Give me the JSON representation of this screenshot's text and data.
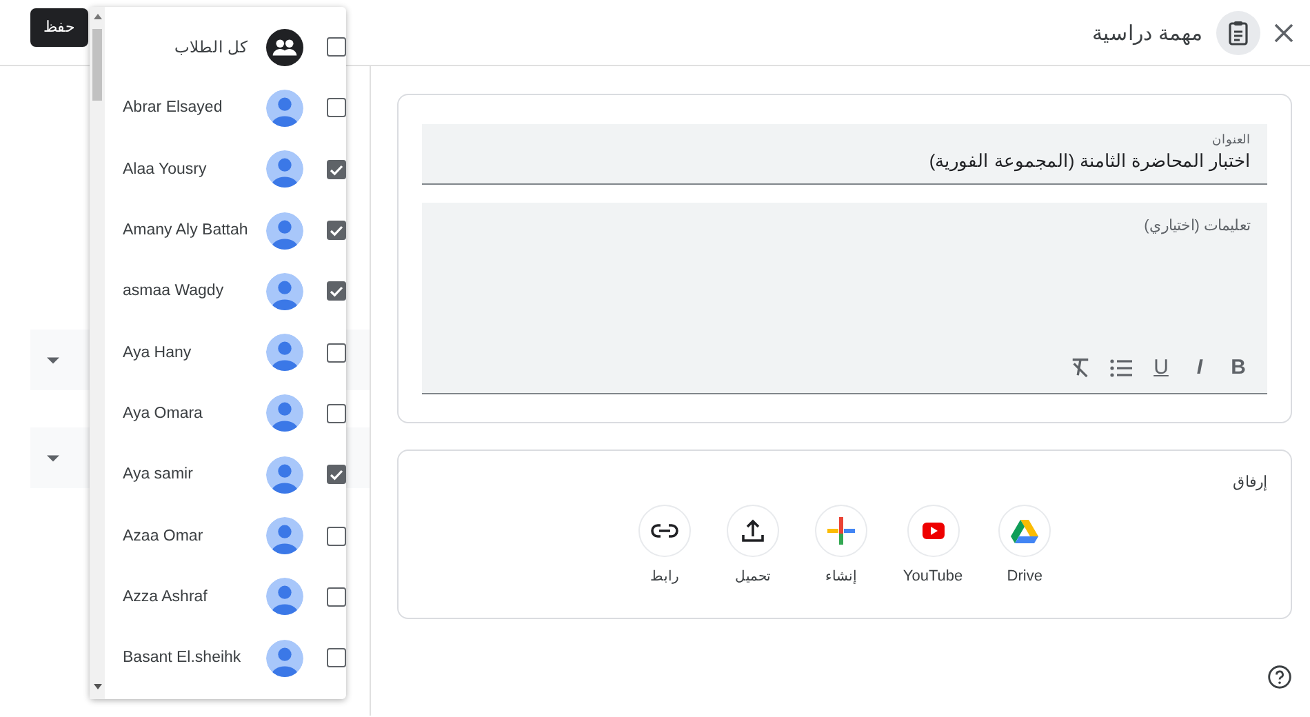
{
  "save_button": "حفظ",
  "header": {
    "title": "مهمة دراسية"
  },
  "left_panel": {
    "dropdowns": [
      {
        "kind": "dropdown"
      },
      {
        "kind": "dropdown"
      }
    ]
  },
  "student_menu": {
    "items": [
      {
        "kind": "all",
        "label": "كل الطلاب",
        "checked": false
      },
      {
        "kind": "student",
        "label": "Abrar Elsayed",
        "checked": false
      },
      {
        "kind": "student",
        "label": "Alaa Yousry",
        "checked": true
      },
      {
        "kind": "student",
        "label": "Amany Aly Battah",
        "checked": true
      },
      {
        "kind": "student",
        "label": "asmaa Wagdy",
        "checked": true
      },
      {
        "kind": "student",
        "label": "Aya Hany",
        "checked": false
      },
      {
        "kind": "student",
        "label": "Aya Omara",
        "checked": false
      },
      {
        "kind": "student",
        "label": "Aya samir",
        "checked": true
      },
      {
        "kind": "student",
        "label": "Azaa Omar",
        "checked": false
      },
      {
        "kind": "student",
        "label": "Azza Ashraf",
        "checked": false
      },
      {
        "kind": "student",
        "label": "Basant El.sheihk",
        "checked": false
      }
    ]
  },
  "form": {
    "title_field": {
      "label": "العنوان",
      "value": "اختبار المحاضرة الثامنة (المجموعة الفورية)"
    },
    "instructions_field": {
      "placeholder": "تعليمات (اختياري)"
    },
    "toolbar": [
      {
        "kind": "bold",
        "label": "B"
      },
      {
        "kind": "italic",
        "label": "I"
      },
      {
        "kind": "underline",
        "label": "U"
      },
      {
        "kind": "list"
      },
      {
        "kind": "clear"
      }
    ]
  },
  "attach": {
    "label": "إرفاق",
    "options": [
      {
        "kind": "drive",
        "label": "Drive"
      },
      {
        "kind": "youtube",
        "label": "YouTube"
      },
      {
        "kind": "create",
        "label": "إنشاء"
      },
      {
        "kind": "upload",
        "label": "تحميل"
      },
      {
        "kind": "link",
        "label": "رابط"
      }
    ]
  }
}
